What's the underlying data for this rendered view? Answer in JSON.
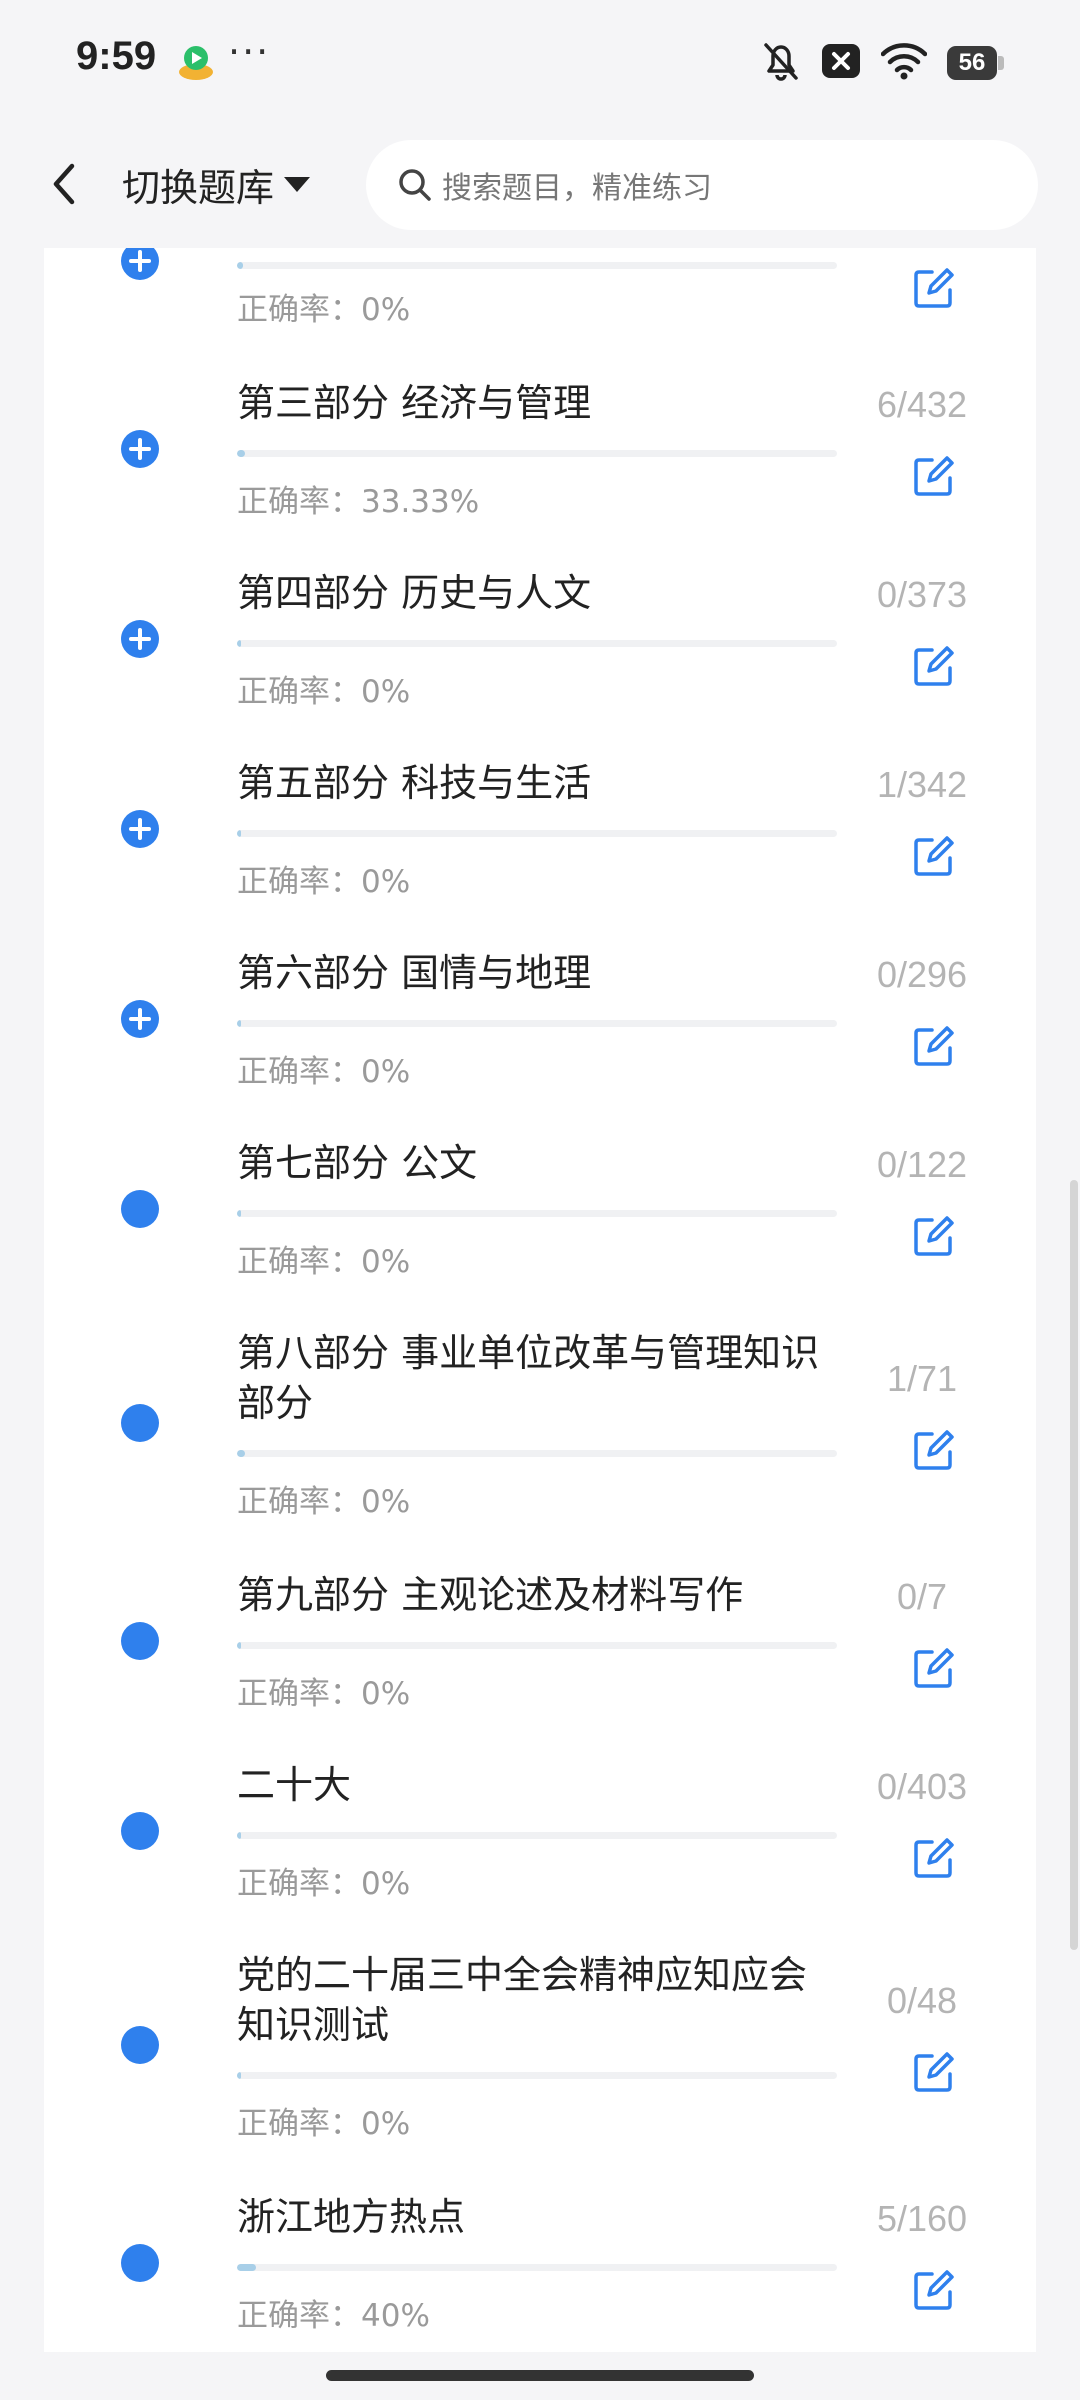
{
  "status_bar": {
    "time": "9:59",
    "overflow": "···",
    "battery": "56",
    "icons": [
      "app-notification-icon",
      "bell-off-icon",
      "close-box-icon",
      "wifi-icon",
      "battery-icon"
    ]
  },
  "header": {
    "bank_label": "切换题库",
    "search_placeholder": "搜索题目，精准练习"
  },
  "colors": {
    "accent": "#2f80ed",
    "progress_fill": "#a8cfe8",
    "muted": "#9a9a9a"
  },
  "items": [
    {
      "title": "",
      "count": "",
      "accuracy": "正确率：0%",
      "progress": 0.01,
      "expandable": true
    },
    {
      "title": "第三部分 经济与管理",
      "count": "6/432",
      "accuracy": "正确率：33.33%",
      "progress": 0.014,
      "expandable": true
    },
    {
      "title": "第四部分 历史与人文",
      "count": "0/373",
      "accuracy": "正确率：0%",
      "progress": 0,
      "expandable": true
    },
    {
      "title": "第五部分 科技与生活",
      "count": "1/342",
      "accuracy": "正确率：0%",
      "progress": 0.003,
      "expandable": true
    },
    {
      "title": "第六部分 国情与地理",
      "count": "0/296",
      "accuracy": "正确率：0%",
      "progress": 0,
      "expandable": true
    },
    {
      "title": "第七部分 公文",
      "count": "0/122",
      "accuracy": "正确率：0%",
      "progress": 0,
      "expandable": false
    },
    {
      "title": "第八部分 事业单位改革与管理知识部分",
      "count": "1/71",
      "accuracy": "正确率：0%",
      "progress": 0.014,
      "expandable": false
    },
    {
      "title": "第九部分 主观论述及材料写作",
      "count": "0/7",
      "accuracy": "正确率：0%",
      "progress": 0,
      "expandable": false
    },
    {
      "title": "二十大",
      "count": "0/403",
      "accuracy": "正确率：0%",
      "progress": 0,
      "expandable": false
    },
    {
      "title": "党的二十届三中全会精神应知应会知识测试",
      "count": "0/48",
      "accuracy": "正确率：0%",
      "progress": 0,
      "expandable": false
    },
    {
      "title": "浙江地方热点",
      "count": "5/160",
      "accuracy": "正确率：40%",
      "progress": 0.031,
      "expandable": false
    }
  ]
}
